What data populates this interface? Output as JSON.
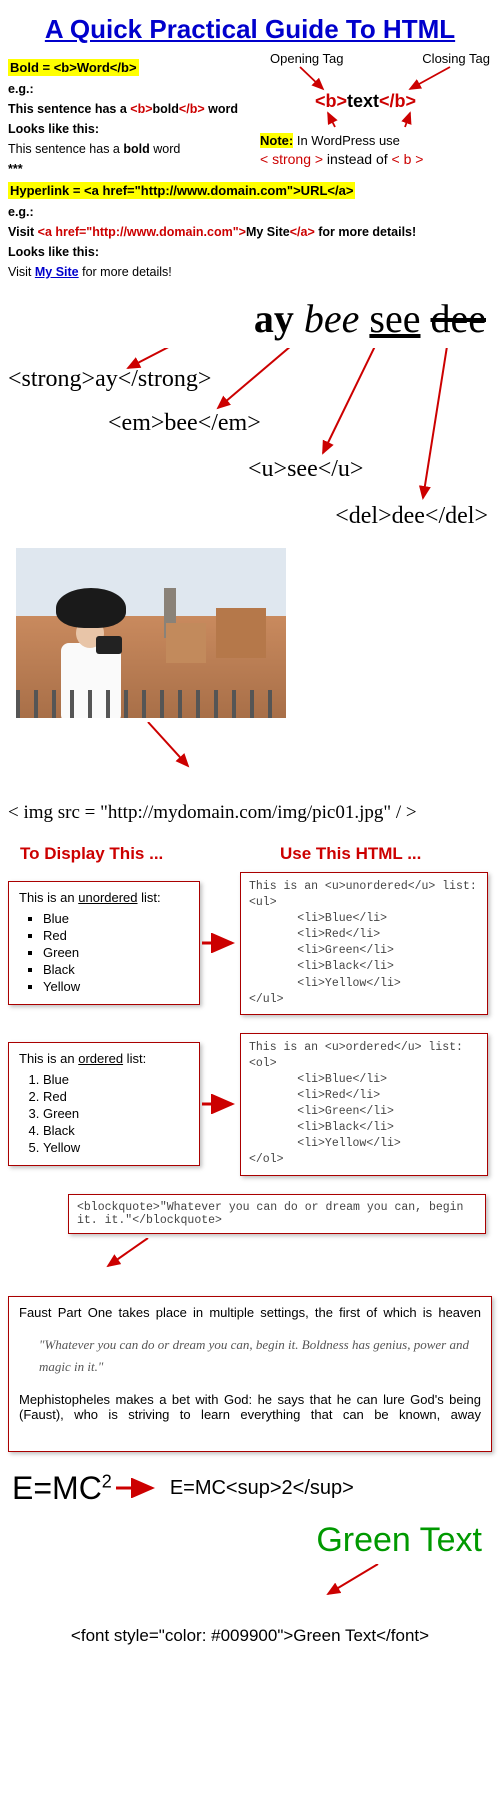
{
  "title": "A Quick Practical Guide To HTML",
  "bold": {
    "formula": "Bold = <b>Word</b>",
    "eg": "e.g.:",
    "src_pre": "This sentence has a ",
    "src_open": "<b>",
    "src_mid": "bold",
    "src_close": "</b>",
    "src_post": " word",
    "looks": "Looks like this:",
    "rendered_pre": "This sentence has a ",
    "rendered_bold": "bold",
    "rendered_post": " word",
    "stars": "***"
  },
  "diagram": {
    "opening": "Opening Tag",
    "closing": "Closing Tag",
    "open": "<b>",
    "text": "text",
    "close": "</b>",
    "note_label": "Note:",
    "note_text": " In WordPress use",
    "strong": "< strong >",
    "instead": " instead of ",
    "b": "< b >"
  },
  "hyper": {
    "formula": "Hyperlink = <a href=\"http://www.domain.com\">URL</a>",
    "eg": "e.g.:",
    "visit": "Visit ",
    "open": "<a href=\"http://www.domain.com\">",
    "mid": "My Site",
    "close": "</a>",
    "post": " for more details!",
    "looks": "Looks like this:",
    "rendered_pre": "Visit ",
    "rendered_link": "My Site",
    "rendered_post": " for more details!"
  },
  "big4": {
    "ay": "ay",
    "bee": "bee",
    "see": "see",
    "dee": "dee"
  },
  "tags": {
    "strong": "<strong>ay</strong>",
    "em": "<em>bee</em>",
    "u": "<u>see</u>",
    "del": "<del>dee</del>"
  },
  "imgline": "< img src = \"http://mydomain.com/img/pic01.jpg\" / >",
  "twohead": {
    "left": "To Display This ...",
    "right": "Use This HTML ..."
  },
  "ul": {
    "head_pre": "This is an ",
    "head_u": "unordered",
    "head_post": " list:",
    "items": [
      "Blue",
      "Red",
      "Green",
      "Black",
      "Yellow"
    ],
    "code": "This is an <u>unordered</u> list:\n<ul>\n       <li>Blue</li>\n       <li>Red</li>\n       <li>Green</li>\n       <li>Black</li>\n       <li>Yellow</li>\n</ul>"
  },
  "ol": {
    "head_pre": "This is an ",
    "head_u": "ordered",
    "head_post": " list:",
    "items": [
      "Blue",
      "Red",
      "Green",
      "Black",
      "Yellow"
    ],
    "code": "This is an <u>ordered</u> list:\n<ol>\n       <li>Blue</li>\n       <li>Red</li>\n       <li>Green</li>\n       <li>Black</li>\n       <li>Yellow</li>\n</ol>"
  },
  "bq": {
    "code": "<blockquote>\"Whatever you can do or dream you can, begin it. it.\"</blockquote>"
  },
  "faust": {
    "p1": "Faust Part One takes place in multiple settings, the first of which is heaven",
    "quote": "\"Whatever you can do or dream you can, begin it. Boldness has genius, power and magic in it.\"",
    "p2": "Mephistopheles makes a bet with God: he says that he can lure God's being (Faust), who is striving to learn everything that can be known, away"
  },
  "emc": {
    "rendered": "E=MC",
    "sup": "2",
    "code": "E=MC<sup>2</sup>"
  },
  "green": {
    "text": "Green Text",
    "code": "<font style=\"color: #009900\">Green Text</font>"
  }
}
